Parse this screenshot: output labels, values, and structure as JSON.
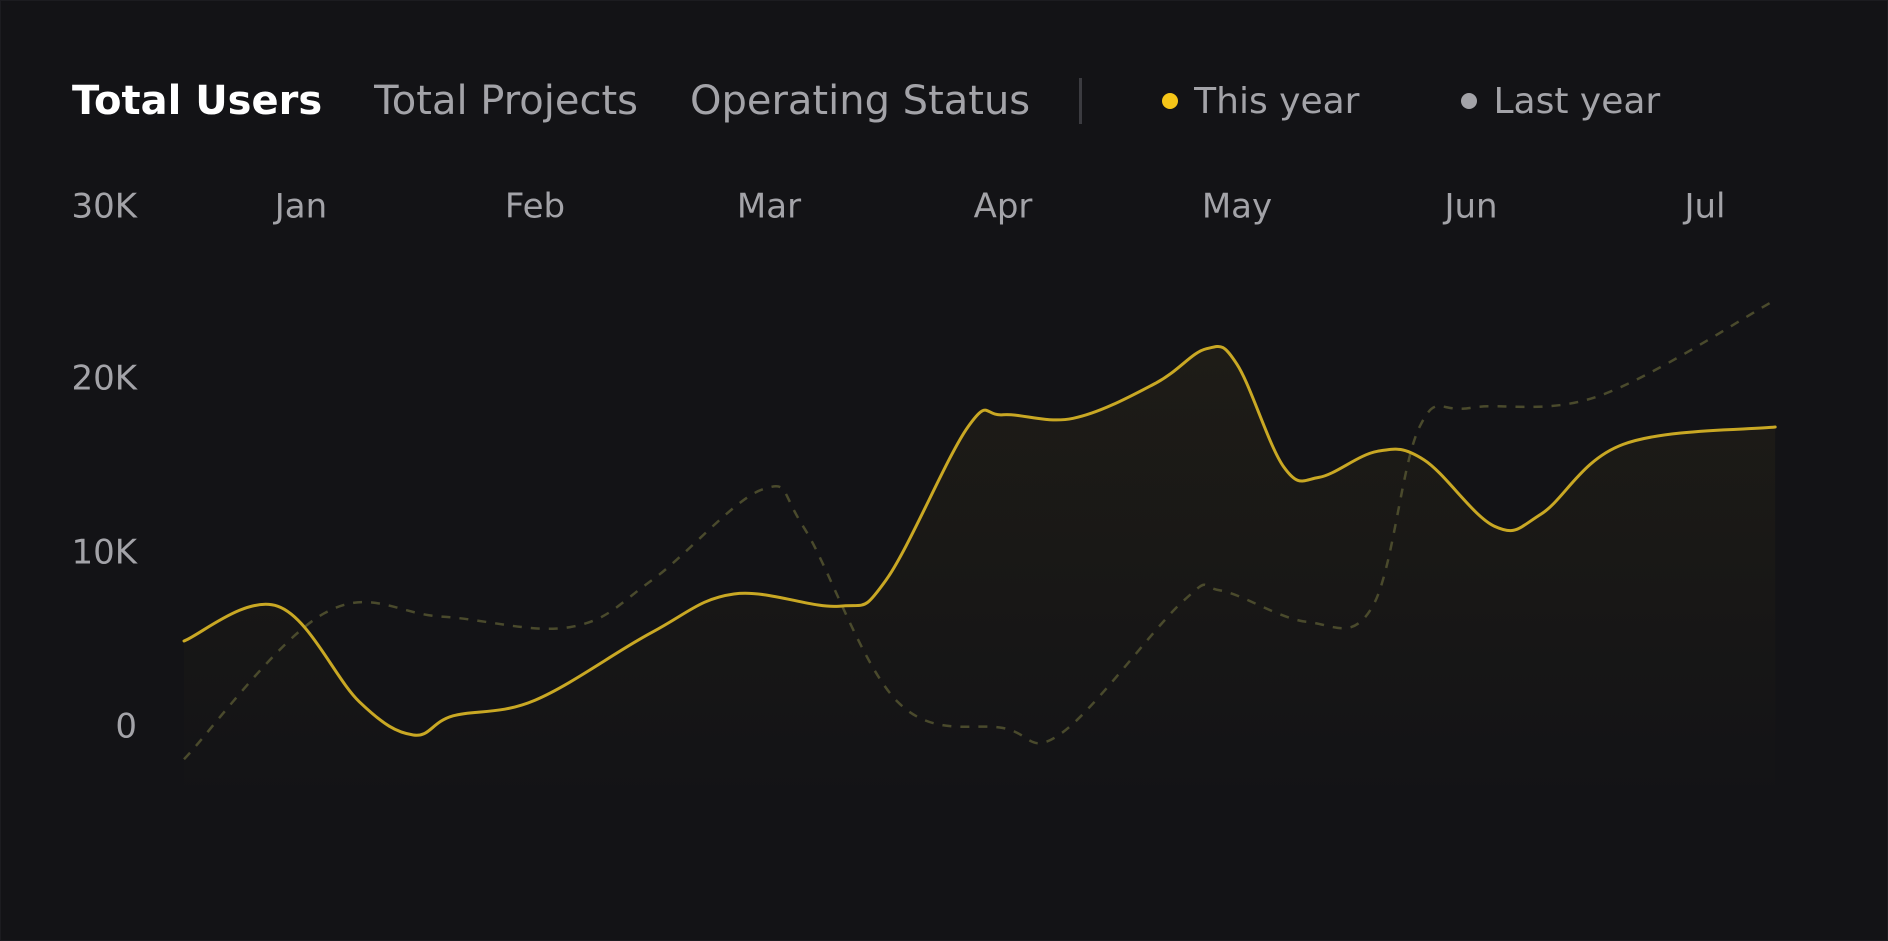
{
  "tabs": [
    {
      "label": "Total Users",
      "active": true
    },
    {
      "label": "Total Projects",
      "active": false
    },
    {
      "label": "Operating Status",
      "active": false
    }
  ],
  "legend": [
    {
      "label": "This year",
      "color": "#f5c518"
    },
    {
      "label": "Last year",
      "color": "#a3a3a8"
    }
  ],
  "colors": {
    "background": "#131316",
    "this_year_line": "#c9a824",
    "last_year_line": "#4a4a2c",
    "tick_text": "#a3a3a8"
  },
  "chart_data": {
    "type": "line",
    "x_ticks": [
      "Jan",
      "Feb",
      "Mar",
      "Apr",
      "May",
      "Jun",
      "Jul"
    ],
    "y_ticks": [
      "0",
      "10K",
      "20K",
      "30K"
    ],
    "ylim": [
      -5000,
      30000
    ],
    "grid": false,
    "legend_position": "top",
    "series": [
      {
        "name": "This year",
        "style": "solid",
        "points": [
          {
            "x": 0.5,
            "y": 5000
          },
          {
            "x": 0.9,
            "y": 7000
          },
          {
            "x": 1.25,
            "y": 1500
          },
          {
            "x": 1.48,
            "y": -400
          },
          {
            "x": 1.65,
            "y": 700
          },
          {
            "x": 2.0,
            "y": 1600
          },
          {
            "x": 2.5,
            "y": 5500
          },
          {
            "x": 2.85,
            "y": 7700
          },
          {
            "x": 3.3,
            "y": 7000
          },
          {
            "x": 3.5,
            "y": 8500
          },
          {
            "x": 3.85,
            "y": 17300
          },
          {
            "x": 4.0,
            "y": 18000
          },
          {
            "x": 4.3,
            "y": 17800
          },
          {
            "x": 4.65,
            "y": 19800
          },
          {
            "x": 4.87,
            "y": 21800
          },
          {
            "x": 5.0,
            "y": 20900
          },
          {
            "x": 5.2,
            "y": 15000
          },
          {
            "x": 5.35,
            "y": 14400
          },
          {
            "x": 5.6,
            "y": 15900
          },
          {
            "x": 5.8,
            "y": 15400
          },
          {
            "x": 6.1,
            "y": 11600
          },
          {
            "x": 6.3,
            "y": 12300
          },
          {
            "x": 6.65,
            "y": 16300
          },
          {
            "x": 7.3,
            "y": 17300
          }
        ]
      },
      {
        "name": "Last year",
        "style": "dashed",
        "points": [
          {
            "x": 0.5,
            "y": -1800
          },
          {
            "x": 1.1,
            "y": 6600
          },
          {
            "x": 1.6,
            "y": 6400
          },
          {
            "x": 2.15,
            "y": 5800
          },
          {
            "x": 2.5,
            "y": 8500
          },
          {
            "x": 2.97,
            "y": 13700
          },
          {
            "x": 3.15,
            "y": 11500
          },
          {
            "x": 3.55,
            "y": 1500
          },
          {
            "x": 4.0,
            "y": 0
          },
          {
            "x": 4.25,
            "y": -300
          },
          {
            "x": 4.77,
            "y": 7300
          },
          {
            "x": 4.93,
            "y": 7900
          },
          {
            "x": 5.3,
            "y": 6100
          },
          {
            "x": 5.58,
            "y": 7000
          },
          {
            "x": 5.78,
            "y": 17300
          },
          {
            "x": 6.0,
            "y": 18400
          },
          {
            "x": 6.55,
            "y": 19100
          },
          {
            "x": 7.3,
            "y": 24600
          }
        ]
      }
    ]
  }
}
